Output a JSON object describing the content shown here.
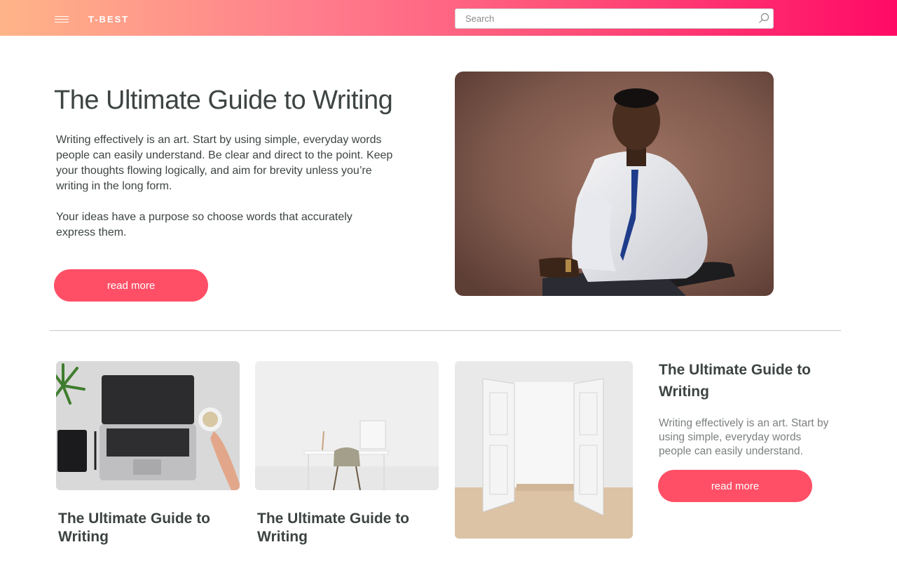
{
  "header": {
    "brand": "T-BEST",
    "search_placeholder": "Search",
    "menu_icon": "hamburger-icon",
    "search_icon": "search-icon",
    "gradient": [
      "#ffb488",
      "#ff4d78",
      "#ff0a66"
    ]
  },
  "hero": {
    "title": "The Ultimate Guide to Writing",
    "paragraph1": "Writing effectively is an art. Start by using simple, everyday words people can easily understand. Be clear and direct to the point. Keep your thoughts flowing logically, and aim for brevity unless you’re writing in the long form.",
    "paragraph2": "Your ideas have a purpose so choose words that accurately express them.",
    "button_label": "read more",
    "button_color": "#ff4f66"
  },
  "cards": [
    {
      "title": "The Ultimate Guide to Writing"
    },
    {
      "title": "The Ultimate Guide to Writing"
    },
    {
      "title": "The Ultimate Guide to Writing",
      "description": "Writing effectively is an art. Start by using simple, everyday words people can easily understand.",
      "button_label": "read more"
    }
  ]
}
